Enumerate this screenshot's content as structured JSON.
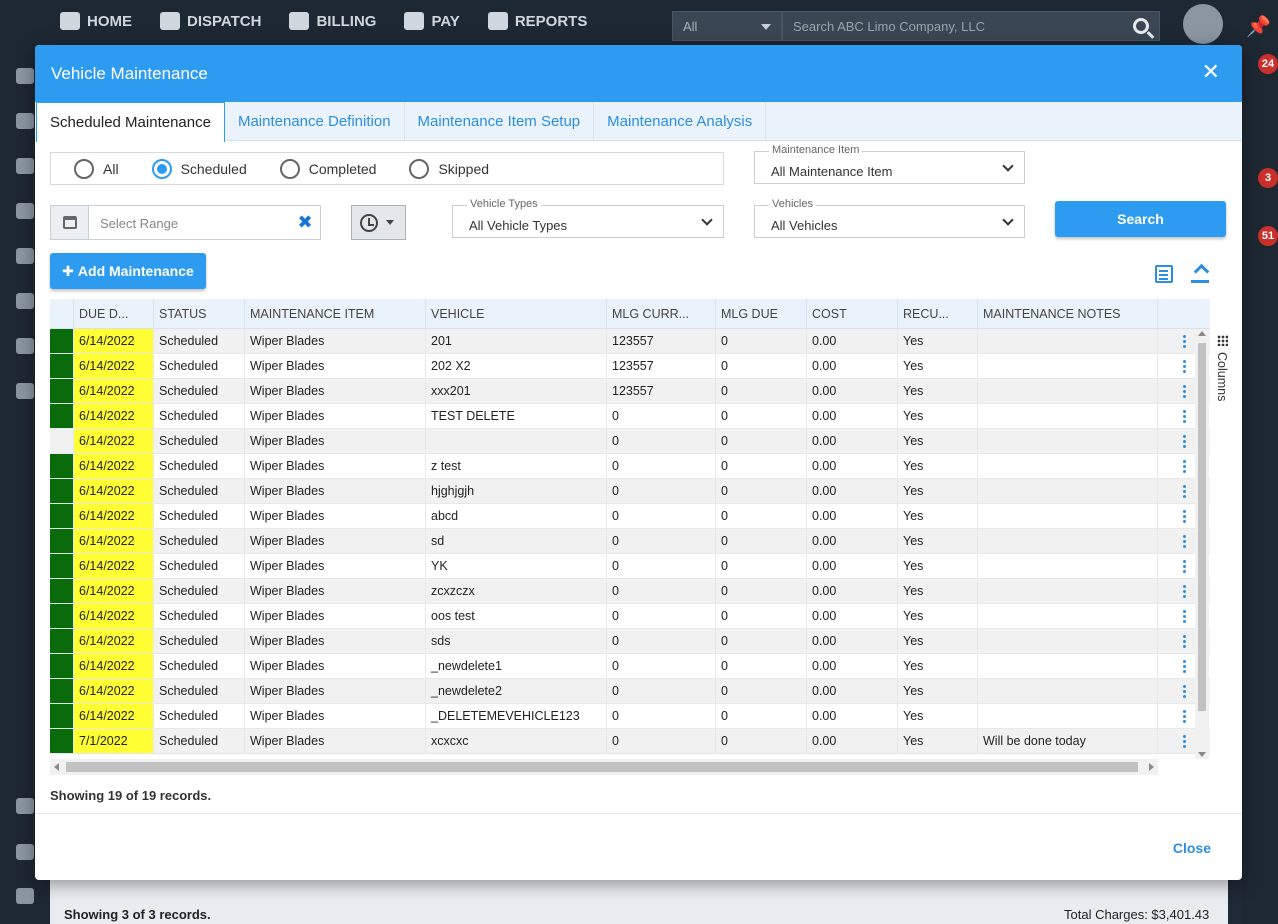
{
  "app": {
    "nav": [
      "HOME",
      "DISPATCH",
      "BILLING",
      "PAY",
      "REPORTS"
    ],
    "search_scope": "All",
    "search_placeholder": "Search ABC Limo Company, LLC",
    "badges": [
      "24",
      "3",
      "51"
    ],
    "bg_footer_left": "Showing 3 of 3 records.",
    "bg_footer_right": "Total Charges: $3,401.43"
  },
  "modal": {
    "title": "Vehicle Maintenance",
    "tabs": [
      "Scheduled Maintenance",
      "Maintenance Definition",
      "Maintenance Item Setup",
      "Maintenance Analysis"
    ],
    "filters": {
      "status_options": [
        "All",
        "Scheduled",
        "Completed",
        "Skipped"
      ],
      "status_selected": "Scheduled",
      "maintenance_item_label": "Maintenance Item",
      "maintenance_item_value": "All Maintenance Item",
      "date_range_placeholder": "Select Range",
      "vehicle_types_label": "Vehicle Types",
      "vehicle_types_value": "All Vehicle Types",
      "vehicles_label": "Vehicles",
      "vehicles_value": "All Vehicles",
      "search_label": "Search"
    },
    "add_label": "Add Maintenance",
    "columns_label": "Columns",
    "grid": {
      "headers": [
        "",
        "DUE D...",
        "STATUS",
        "MAINTENANCE ITEM",
        "VEHICLE",
        "MLG CURR...",
        "MLG DUE",
        "COST",
        "RECU...",
        "MAINTENANCE NOTES",
        ""
      ],
      "rows": [
        {
          "indicator": true,
          "due": "6/14/2022",
          "status": "Scheduled",
          "item": "Wiper Blades",
          "vehicle": "201",
          "mlg_curr": "123557",
          "mlg_due": "0",
          "cost": "0.00",
          "recurring": "Yes",
          "notes": ""
        },
        {
          "indicator": true,
          "due": "6/14/2022",
          "status": "Scheduled",
          "item": "Wiper Blades",
          "vehicle": "202 X2",
          "mlg_curr": "123557",
          "mlg_due": "0",
          "cost": "0.00",
          "recurring": "Yes",
          "notes": ""
        },
        {
          "indicator": true,
          "due": "6/14/2022",
          "status": "Scheduled",
          "item": "Wiper Blades",
          "vehicle": "xxx201",
          "mlg_curr": "123557",
          "mlg_due": "0",
          "cost": "0.00",
          "recurring": "Yes",
          "notes": ""
        },
        {
          "indicator": true,
          "due": "6/14/2022",
          "status": "Scheduled",
          "item": "Wiper Blades",
          "vehicle": "TEST DELETE",
          "mlg_curr": "0",
          "mlg_due": "0",
          "cost": "0.00",
          "recurring": "Yes",
          "notes": ""
        },
        {
          "indicator": false,
          "due": "6/14/2022",
          "status": "Scheduled",
          "item": "Wiper Blades",
          "vehicle": "",
          "mlg_curr": "0",
          "mlg_due": "0",
          "cost": "0.00",
          "recurring": "Yes",
          "notes": ""
        },
        {
          "indicator": true,
          "due": "6/14/2022",
          "status": "Scheduled",
          "item": "Wiper Blades",
          "vehicle": "z test",
          "mlg_curr": "0",
          "mlg_due": "0",
          "cost": "0.00",
          "recurring": "Yes",
          "notes": ""
        },
        {
          "indicator": true,
          "due": "6/14/2022",
          "status": "Scheduled",
          "item": "Wiper Blades",
          "vehicle": "hjghjgjh",
          "mlg_curr": "0",
          "mlg_due": "0",
          "cost": "0.00",
          "recurring": "Yes",
          "notes": ""
        },
        {
          "indicator": true,
          "due": "6/14/2022",
          "status": "Scheduled",
          "item": "Wiper Blades",
          "vehicle": "abcd",
          "mlg_curr": "0",
          "mlg_due": "0",
          "cost": "0.00",
          "recurring": "Yes",
          "notes": ""
        },
        {
          "indicator": true,
          "due": "6/14/2022",
          "status": "Scheduled",
          "item": "Wiper Blades",
          "vehicle": "sd",
          "mlg_curr": "0",
          "mlg_due": "0",
          "cost": "0.00",
          "recurring": "Yes",
          "notes": ""
        },
        {
          "indicator": true,
          "due": "6/14/2022",
          "status": "Scheduled",
          "item": "Wiper Blades",
          "vehicle": "YK",
          "mlg_curr": "0",
          "mlg_due": "0",
          "cost": "0.00",
          "recurring": "Yes",
          "notes": ""
        },
        {
          "indicator": true,
          "due": "6/14/2022",
          "status": "Scheduled",
          "item": "Wiper Blades",
          "vehicle": "zcxzczx",
          "mlg_curr": "0",
          "mlg_due": "0",
          "cost": "0.00",
          "recurring": "Yes",
          "notes": ""
        },
        {
          "indicator": true,
          "due": "6/14/2022",
          "status": "Scheduled",
          "item": "Wiper Blades",
          "vehicle": "oos test",
          "mlg_curr": "0",
          "mlg_due": "0",
          "cost": "0.00",
          "recurring": "Yes",
          "notes": ""
        },
        {
          "indicator": true,
          "due": "6/14/2022",
          "status": "Scheduled",
          "item": "Wiper Blades",
          "vehicle": "sds",
          "mlg_curr": "0",
          "mlg_due": "0",
          "cost": "0.00",
          "recurring": "Yes",
          "notes": ""
        },
        {
          "indicator": true,
          "due": "6/14/2022",
          "status": "Scheduled",
          "item": "Wiper Blades",
          "vehicle": "_newdelete1",
          "mlg_curr": "0",
          "mlg_due": "0",
          "cost": "0.00",
          "recurring": "Yes",
          "notes": ""
        },
        {
          "indicator": true,
          "due": "6/14/2022",
          "status": "Scheduled",
          "item": "Wiper Blades",
          "vehicle": "_newdelete2",
          "mlg_curr": "0",
          "mlg_due": "0",
          "cost": "0.00",
          "recurring": "Yes",
          "notes": ""
        },
        {
          "indicator": true,
          "due": "6/14/2022",
          "status": "Scheduled",
          "item": "Wiper Blades",
          "vehicle": "_DELETEMEVEHICLE123",
          "mlg_curr": "0",
          "mlg_due": "0",
          "cost": "0.00",
          "recurring": "Yes",
          "notes": ""
        },
        {
          "indicator": true,
          "due": "7/1/2022",
          "status": "Scheduled",
          "item": "Wiper Blades",
          "vehicle": "xcxcxc",
          "mlg_curr": "0",
          "mlg_due": "0",
          "cost": "0.00",
          "recurring": "Yes",
          "notes": "Will be done today"
        }
      ]
    },
    "records_text": "Showing 19 of 19 records.",
    "close_label": "Close",
    "colors": {
      "primary": "#2d9bf0",
      "indicator_green": "#0a6b0a",
      "due_highlight": "#ffff33"
    }
  }
}
